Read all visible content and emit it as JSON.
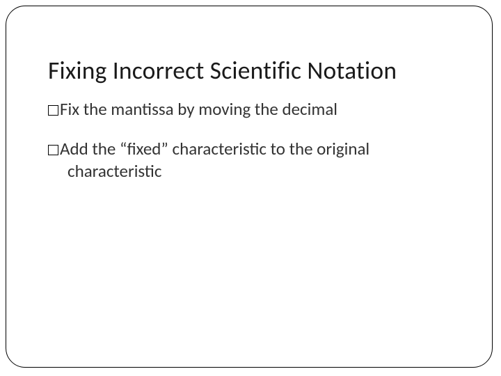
{
  "slide": {
    "title": "Fixing Incorrect Scientific Notation",
    "bullets": [
      {
        "text": "Fix the mantissa by moving the decimal"
      },
      {
        "text": "Add the “fixed” characteristic to the original"
      },
      {
        "text_cont": "characteristic"
      }
    ]
  }
}
